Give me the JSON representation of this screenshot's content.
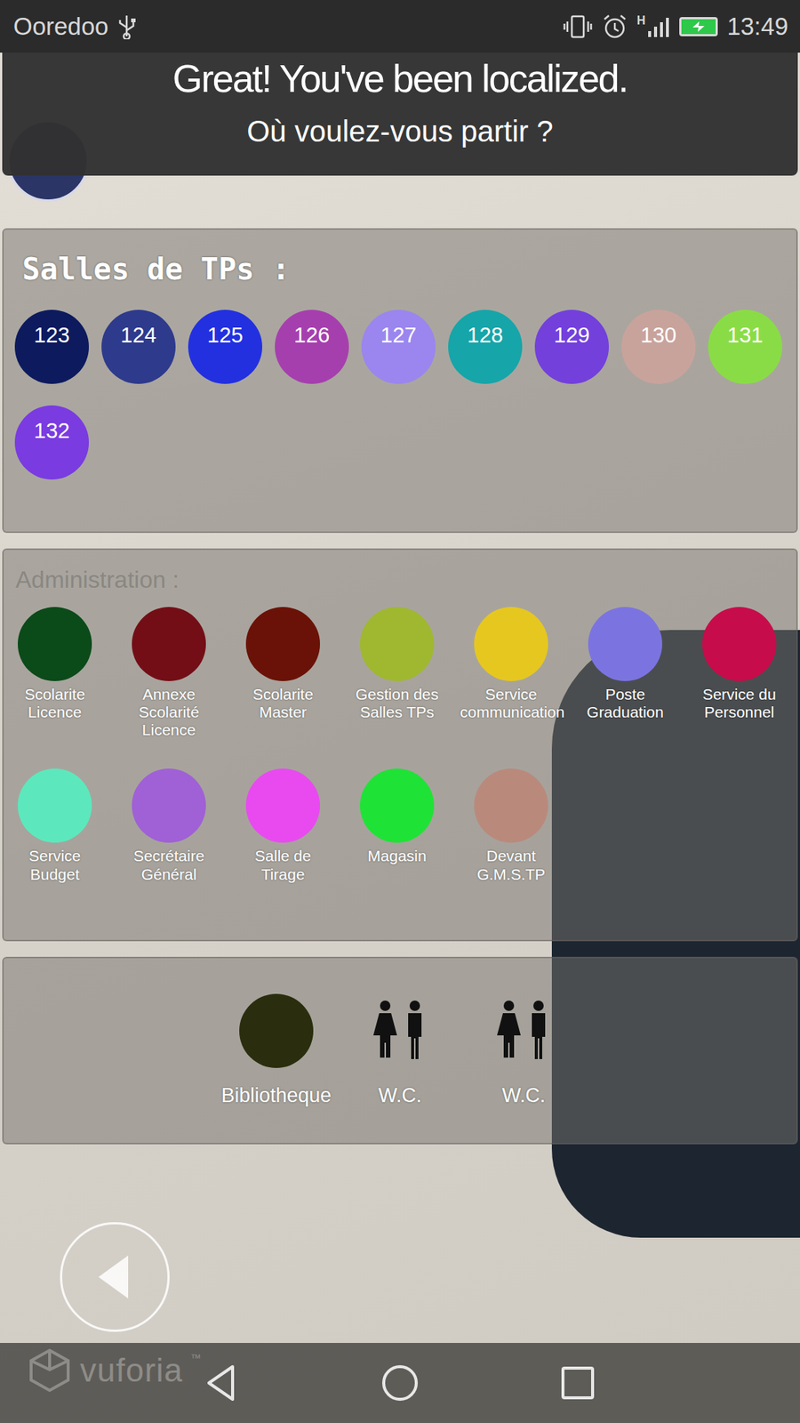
{
  "status_bar": {
    "carrier": "Ooredoo",
    "network": "H",
    "time": "13:49",
    "battery": {
      "level": 1,
      "charging": true
    }
  },
  "toast": {
    "title": "Great! You've been localized.",
    "subtitle": "Où voulez-vous partir ?"
  },
  "tp_section": {
    "title": "Salles de TPs :",
    "rooms": [
      {
        "label": "123",
        "color": "#0d1a5e"
      },
      {
        "label": "124",
        "color": "#2e3a8c"
      },
      {
        "label": "125",
        "color": "#2230e0"
      },
      {
        "label": "126",
        "color": "#a63fae"
      },
      {
        "label": "127",
        "color": "#9a86ee"
      },
      {
        "label": "128",
        "color": "#16a5a9"
      },
      {
        "label": "129",
        "color": "#7340dc"
      },
      {
        "label": "130",
        "color": "#c8a39c"
      },
      {
        "label": "131",
        "color": "#8adc46"
      },
      {
        "label": "132",
        "color": "#7a3be0"
      }
    ]
  },
  "admin_section": {
    "title": "Administration :",
    "items": [
      {
        "label": "Scolarite Licence",
        "color": "#0b4a19"
      },
      {
        "label": "Annexe Scolarité Licence",
        "color": "#730e16"
      },
      {
        "label": "Scolarite Master",
        "color": "#6a1207"
      },
      {
        "label": "Gestion des Salles TPs",
        "color": "#9fb830"
      },
      {
        "label": "Service communication",
        "color": "#e6c720"
      },
      {
        "label": "Poste Graduation",
        "color": "#7b74e0"
      },
      {
        "label": "Service du Personnel",
        "color": "#c70c4b"
      },
      {
        "label": "Service Budget",
        "color": "#5ce8bc"
      },
      {
        "label": "Secrétaire Général",
        "color": "#a060d6"
      },
      {
        "label": "Salle de Tirage",
        "color": "#e84af0"
      },
      {
        "label": "Magasin",
        "color": "#1fe236"
      },
      {
        "label": "Devant G.M.S.TP",
        "color": "#b98a7c"
      }
    ]
  },
  "facilities": [
    {
      "label": "Bibliotheque",
      "kind": "circle",
      "color": "#2a2e0e"
    },
    {
      "label": "W.C.",
      "kind": "restroom",
      "color": "#111111"
    },
    {
      "label": "W.C.",
      "kind": "restroom",
      "color": "#111111"
    }
  ],
  "watermark": {
    "text": "vuforia",
    "mark": "™"
  }
}
